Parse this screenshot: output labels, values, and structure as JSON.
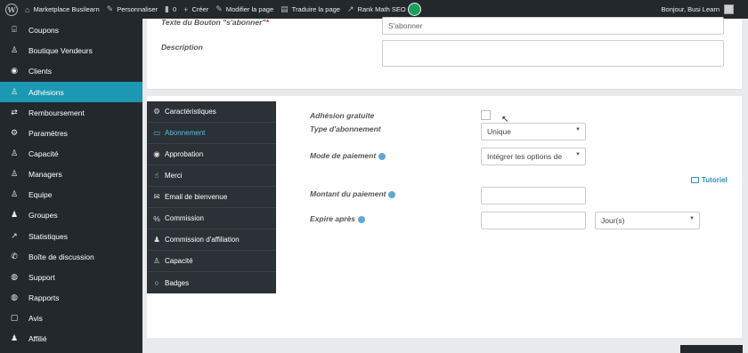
{
  "adminbar": {
    "site_name": "Marketplace Busilearn",
    "customize": "Personnaliser",
    "comments_count": "0",
    "create": "Créer",
    "edit_page": "Modifier la page",
    "translate_page": "Traduire la page",
    "rank_math": "Rank Math SEO",
    "greeting": "Bonjour, Busi Learn"
  },
  "sidebar": {
    "items": [
      {
        "label": "Coupons",
        "icon": "gift-icon"
      },
      {
        "label": "Boutique Vendeurs",
        "icon": "user-icon"
      },
      {
        "label": "Clients",
        "icon": "user-circle-icon"
      },
      {
        "label": "Adhésions",
        "icon": "user-plus-icon",
        "active": true
      },
      {
        "label": "Remboursement",
        "icon": "refund-arrows-icon"
      },
      {
        "label": "Paramètres",
        "icon": "gears-icon"
      },
      {
        "label": "Capacité",
        "icon": "user-plus-icon"
      },
      {
        "label": "Managers",
        "icon": "user-icon"
      },
      {
        "label": "Equipe",
        "icon": "user-icon"
      },
      {
        "label": "Groupes",
        "icon": "users-icon"
      },
      {
        "label": "Statistiques",
        "icon": "chart-line-icon"
      },
      {
        "label": "Boîte de discussion",
        "icon": "chat-icon"
      },
      {
        "label": "Support",
        "icon": "globe-icon"
      },
      {
        "label": "Rapports",
        "icon": "globe-icon"
      },
      {
        "label": "Avis",
        "icon": "comment-icon"
      },
      {
        "label": "Affilié",
        "icon": "users-icon"
      }
    ]
  },
  "form_top": {
    "button_text_label": "Texte du Bouton \"s'abonner\"",
    "button_text_value": "S'abonner",
    "description_label": "Description",
    "description_value": ""
  },
  "tabs": [
    {
      "label": "Caractéristiques",
      "icon": "gear-icon"
    },
    {
      "label": "Abonnement",
      "icon": "card-icon",
      "active": true
    },
    {
      "label": "Approbation",
      "icon": "circle-check-icon"
    },
    {
      "label": "Merci",
      "icon": "thumbs-up-icon"
    },
    {
      "label": "Email de bienvenue",
      "icon": "envelope-icon"
    },
    {
      "label": "Commission",
      "icon": "percent-icon"
    },
    {
      "label": "Commission d'affiliation",
      "icon": "users-icon"
    },
    {
      "label": "Capacité",
      "icon": "user-plus-icon"
    },
    {
      "label": "Badges",
      "icon": "circle-icon"
    }
  ],
  "subscription": {
    "free_label": "Adhésion gratuite",
    "type_label": "Type d'abonnement",
    "type_value": "Unique",
    "payment_label": "Mode de paiement",
    "payment_value": "Intégrer les options de",
    "amount_label": "Montant du paiement",
    "amount_value": "",
    "expires_label": "Expire après",
    "expires_value": "",
    "expires_unit": "Jour(s)",
    "tutorial": "Tutoriel"
  }
}
